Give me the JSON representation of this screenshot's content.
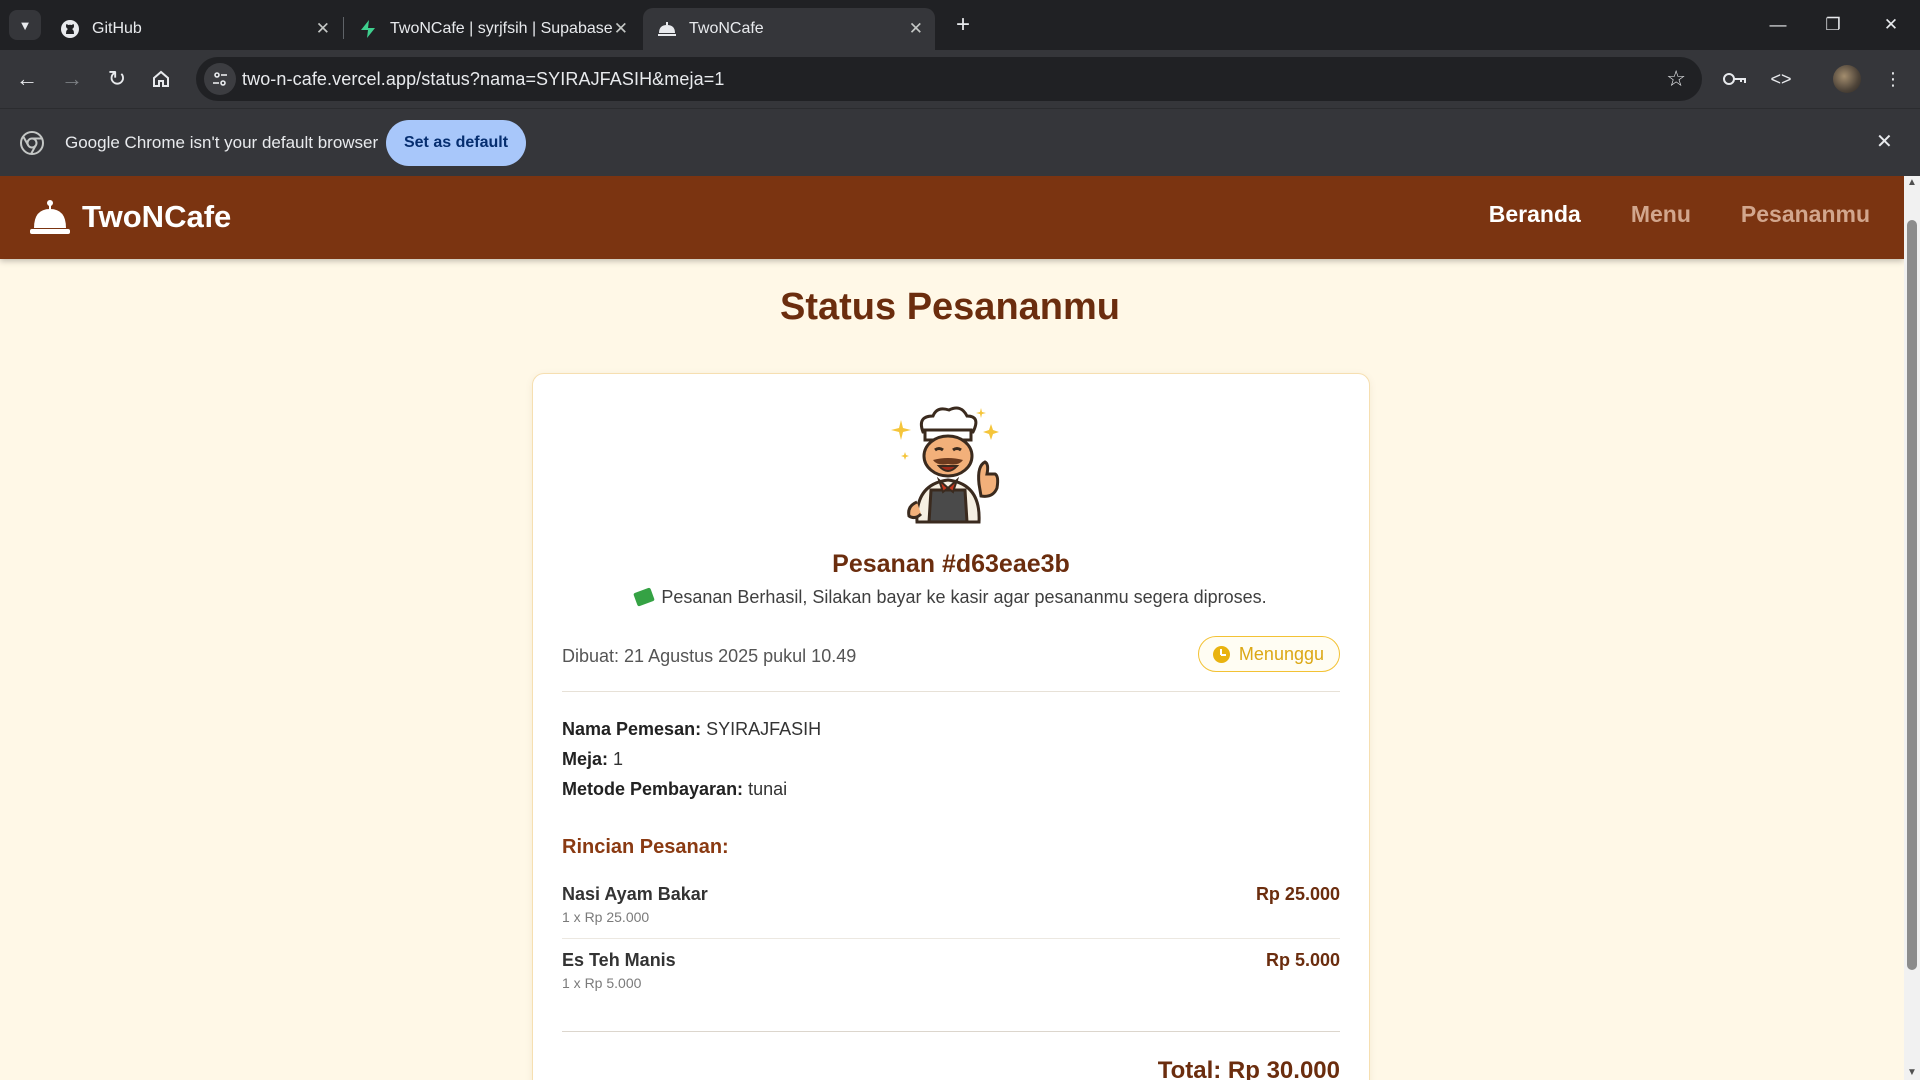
{
  "browser": {
    "tabs": [
      {
        "title": "GitHub",
        "icon": "github-icon"
      },
      {
        "title": "TwoNCafe | syrjfsih | Supabase",
        "icon": "supabase-icon"
      },
      {
        "title": "TwoNCafe",
        "icon": "cloche-icon",
        "active": true
      }
    ],
    "url": "two-n-cafe.vercel.app/status?nama=SYIRAJFASIH&meja=1",
    "infobar": {
      "message": "Google Chrome isn't your default browser",
      "button": "Set as default"
    }
  },
  "site": {
    "brand": "TwoNCafe",
    "nav": [
      {
        "label": "Beranda",
        "active": true
      },
      {
        "label": "Menu",
        "active": false
      },
      {
        "label": "Pesananmu",
        "active": false
      }
    ]
  },
  "page": {
    "title": "Status Pesananmu",
    "order": {
      "number": "Pesanan #d63eae3b",
      "message": "Pesanan Berhasil, Silakan bayar ke kasir agar pesananmu segera diproses.",
      "created": "Dibuat: 21 Agustus 2025 pukul 10.49",
      "status": "Menunggu",
      "status_color": "#dca815",
      "customer_label": "Nama Pemesan:",
      "customer": "SYIRAJFASIH",
      "table_label": "Meja:",
      "table": "1",
      "payment_label": "Metode Pembayaran:",
      "payment": "tunai",
      "details_title": "Rincian Pesanan:",
      "items": [
        {
          "name": "Nasi Ayam Bakar",
          "qty_price": "1 x Rp 25.000",
          "subtotal": "Rp 25.000"
        },
        {
          "name": "Es Teh Manis",
          "qty_price": "1 x Rp 5.000",
          "subtotal": "Rp 5.000"
        }
      ],
      "total": "Total: Rp 30.000"
    }
  },
  "colors": {
    "nav_bg": "#7b3411",
    "page_bg": "#fff8e7",
    "accent": "#6b2d0e"
  }
}
